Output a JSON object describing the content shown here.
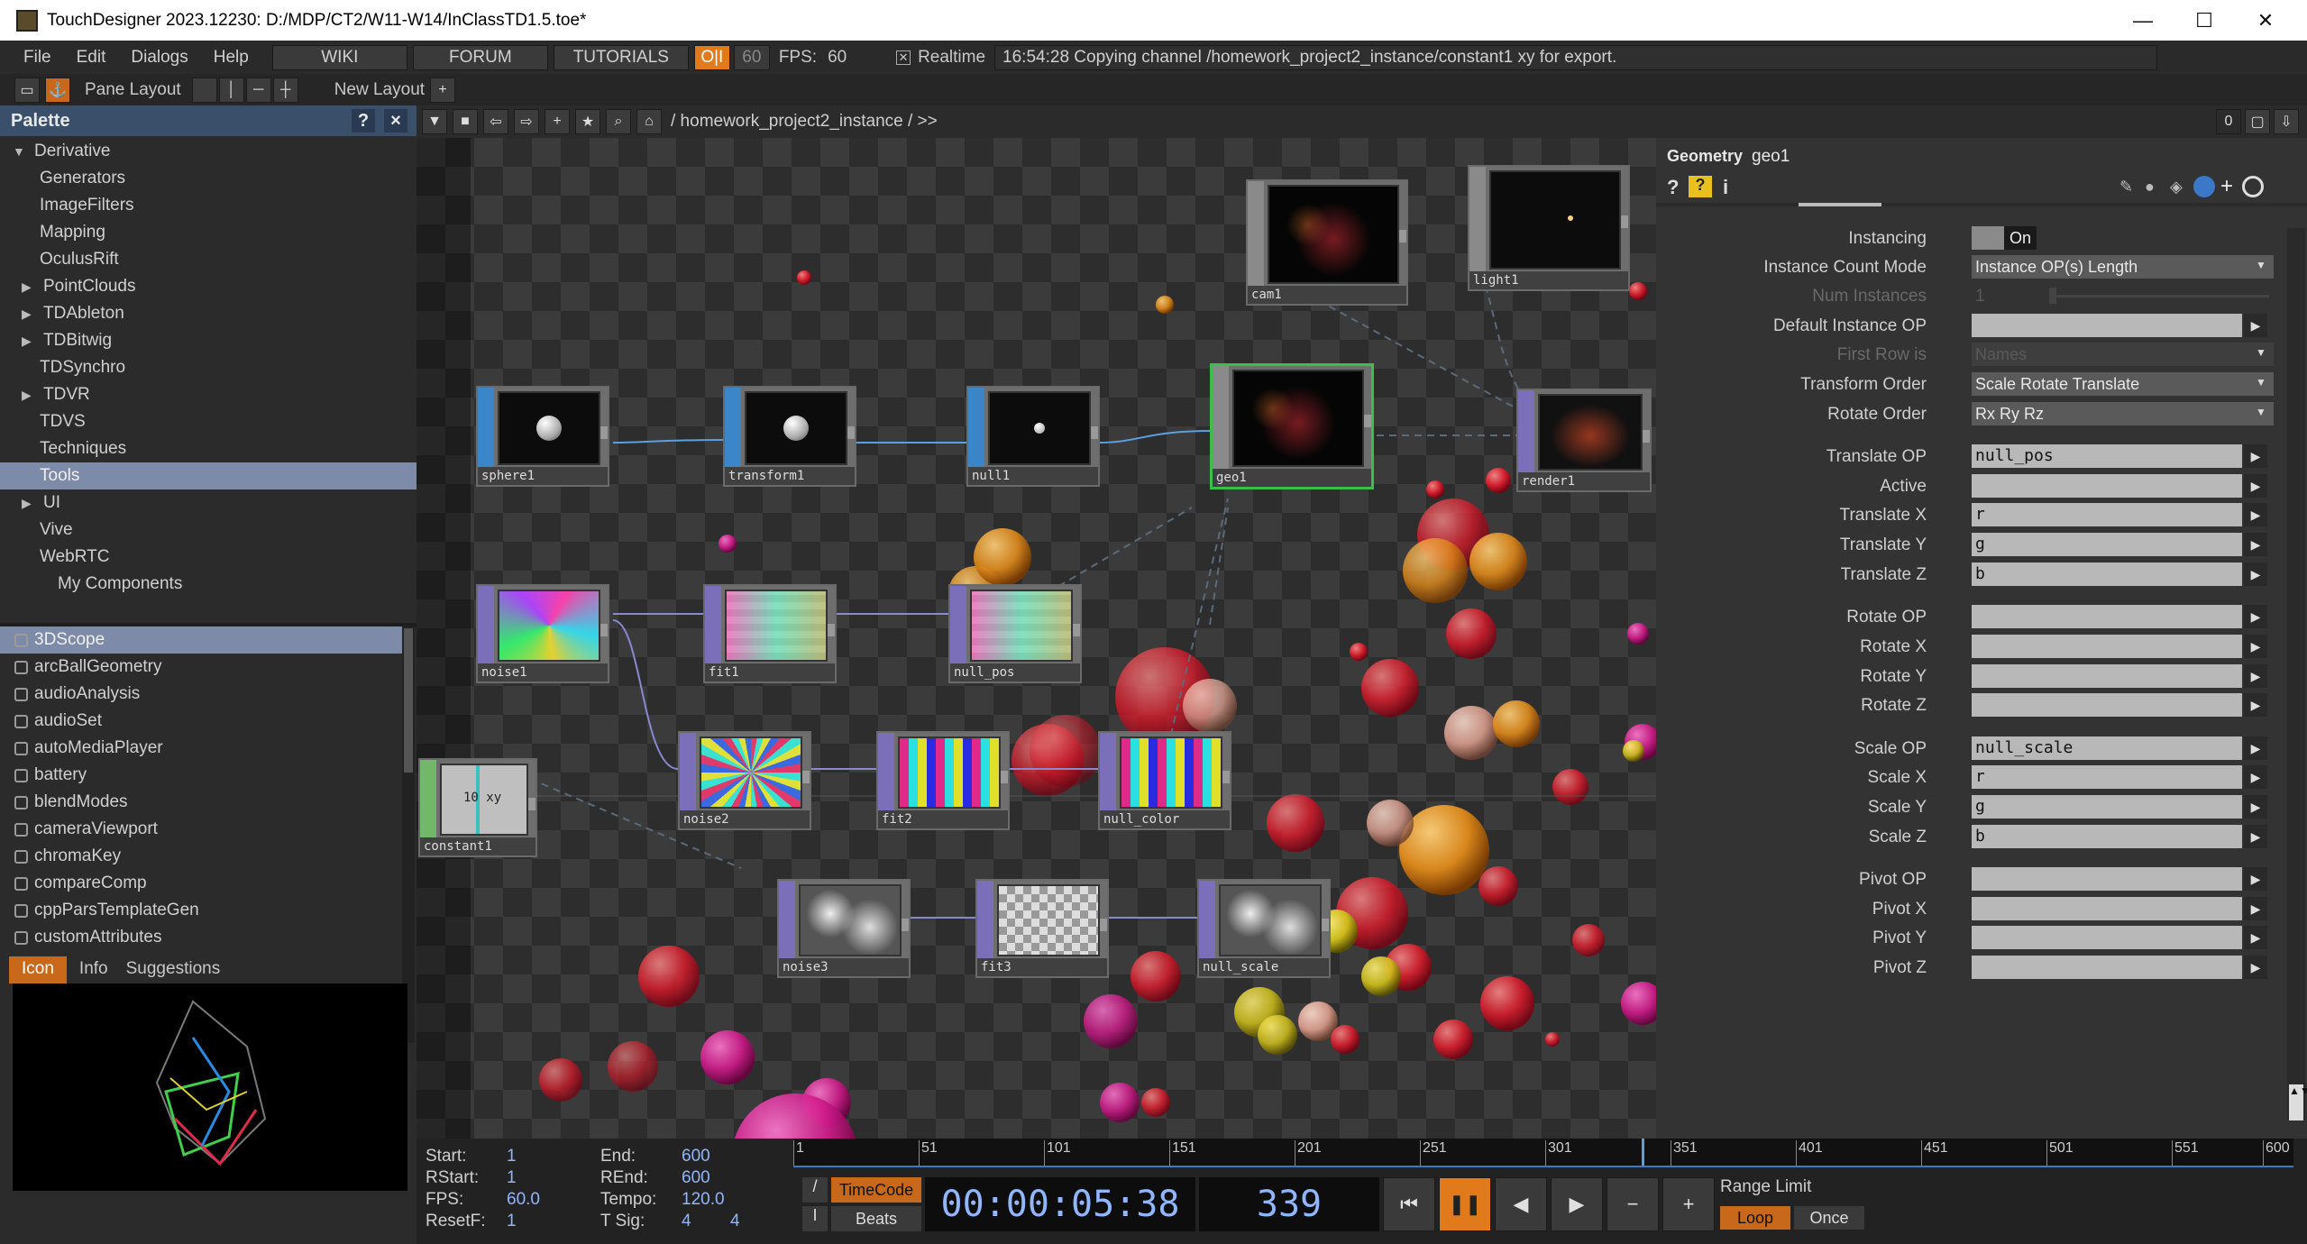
{
  "window": {
    "title": "TouchDesigner 2023.12230: D:/MDP/CT2/W11-W14/InClassTD1.5.toe*",
    "min": "—",
    "max": "☐",
    "close": "✕"
  },
  "menu": {
    "file": "File",
    "edit": "Edit",
    "dialogs": "Dialogs",
    "help": "Help",
    "wiki": "WIKI",
    "forum": "FORUM",
    "tutorials": "TUTORIALS",
    "oi": "O|I",
    "fps_target": "60",
    "fps_label": "FPS:",
    "fps_value": "60",
    "realtime": "Realtime",
    "status": "16:54:28 Copying channel /homework_project2_instance/constant1 xy for export."
  },
  "toolbar2": {
    "pane_layout": "Pane Layout",
    "new_layout": "New Layout",
    "plus": "+"
  },
  "palette": {
    "title": "Palette",
    "help": "?",
    "close": "×",
    "tree": [
      {
        "label": "Derivative",
        "indent": 0,
        "arrow": "▼",
        "selected": false
      },
      {
        "label": "Generators",
        "indent": 2,
        "arrow": "",
        "selected": false
      },
      {
        "label": "ImageFilters",
        "indent": 2,
        "arrow": "",
        "selected": false
      },
      {
        "label": "Mapping",
        "indent": 2,
        "arrow": "",
        "selected": false
      },
      {
        "label": "OculusRift",
        "indent": 2,
        "arrow": "",
        "selected": false
      },
      {
        "label": "PointClouds",
        "indent": 2,
        "arrow": "▶",
        "selected": false
      },
      {
        "label": "TDAbleton",
        "indent": 2,
        "arrow": "▶",
        "selected": false
      },
      {
        "label": "TDBitwig",
        "indent": 2,
        "arrow": "▶",
        "selected": false
      },
      {
        "label": "TDSynchro",
        "indent": 2,
        "arrow": "",
        "selected": false
      },
      {
        "label": "TDVR",
        "indent": 2,
        "arrow": "▶",
        "selected": false
      },
      {
        "label": "TDVS",
        "indent": 2,
        "arrow": "",
        "selected": false
      },
      {
        "label": "Techniques",
        "indent": 2,
        "arrow": "",
        "selected": false
      },
      {
        "label": "Tools",
        "indent": 2,
        "arrow": "",
        "selected": true
      },
      {
        "label": "UI",
        "indent": 2,
        "arrow": "▶",
        "selected": false
      },
      {
        "label": "Vive",
        "indent": 2,
        "arrow": "",
        "selected": false
      },
      {
        "label": "WebRTC",
        "indent": 2,
        "arrow": "",
        "selected": false
      },
      {
        "label": "My Components",
        "indent": 1,
        "arrow": "",
        "selected": false
      }
    ],
    "components": [
      "3DScope",
      "arcBallGeometry",
      "audioAnalysis",
      "audioSet",
      "autoMediaPlayer",
      "battery",
      "blendModes",
      "cameraViewport",
      "chromaKey",
      "compareComp",
      "cppParsTemplateGen",
      "customAttributes"
    ],
    "tabs": {
      "icon": "Icon",
      "info": "Info",
      "suggestions": "Suggestions"
    }
  },
  "network": {
    "path": "/ homework_project2_instance / >>",
    "right_count": "0",
    "nodes": [
      {
        "id": "sphere1",
        "name": "sphere1"
      },
      {
        "id": "transform1",
        "name": "transform1"
      },
      {
        "id": "null1",
        "name": "null1"
      },
      {
        "id": "geo1",
        "name": "geo1"
      },
      {
        "id": "cam1",
        "name": "cam1"
      },
      {
        "id": "light1",
        "name": "light1"
      },
      {
        "id": "render1",
        "name": "render1"
      },
      {
        "id": "noise1",
        "name": "noise1"
      },
      {
        "id": "fit1",
        "name": "fit1"
      },
      {
        "id": "null_pos",
        "name": "null_pos"
      },
      {
        "id": "constant1",
        "name": "constant1",
        "value": "10 xy"
      },
      {
        "id": "noise2",
        "name": "noise2"
      },
      {
        "id": "fit2",
        "name": "fit2"
      },
      {
        "id": "null_color",
        "name": "null_color"
      },
      {
        "id": "noise3",
        "name": "noise3"
      },
      {
        "id": "fit3",
        "name": "fit3"
      },
      {
        "id": "null_scale",
        "name": "null_scale"
      }
    ]
  },
  "params": {
    "op_type": "Geometry",
    "op_name": "geo1",
    "rows": [
      {
        "label": "Instancing",
        "kind": "toggle",
        "value": "On",
        "dim": false
      },
      {
        "label": "Instance Count Mode",
        "kind": "menu",
        "value": "Instance OP(s) Length",
        "dim": false
      },
      {
        "label": "Num Instances",
        "kind": "slider",
        "value": "1",
        "dim": true
      },
      {
        "label": "Default Instance OP",
        "kind": "field",
        "value": "",
        "dim": false
      },
      {
        "label": "First Row is",
        "kind": "menu",
        "value": "Names",
        "dim": true
      },
      {
        "label": "Transform Order",
        "kind": "menu",
        "value": "Scale Rotate Translate",
        "dim": false
      },
      {
        "label": "Rotate Order",
        "kind": "menu",
        "value": "Rx Ry Rz",
        "dim": false
      },
      {
        "label": "Translate OP",
        "kind": "field",
        "value": "null_pos",
        "dim": false
      },
      {
        "label": "Active",
        "kind": "field",
        "value": "",
        "dim": false
      },
      {
        "label": "Translate X",
        "kind": "field",
        "value": "r",
        "dim": false
      },
      {
        "label": "Translate Y",
        "kind": "field",
        "value": "g",
        "dim": false
      },
      {
        "label": "Translate Z",
        "kind": "field",
        "value": "b",
        "dim": false
      },
      {
        "label": "Rotate OP",
        "kind": "field",
        "value": "",
        "dim": false
      },
      {
        "label": "Rotate X",
        "kind": "field",
        "value": "",
        "dim": false
      },
      {
        "label": "Rotate Y",
        "kind": "field",
        "value": "",
        "dim": false
      },
      {
        "label": "Rotate Z",
        "kind": "field",
        "value": "",
        "dim": false
      },
      {
        "label": "Scale OP",
        "kind": "field",
        "value": "null_scale",
        "dim": false
      },
      {
        "label": "Scale X",
        "kind": "field",
        "value": "r",
        "dim": false
      },
      {
        "label": "Scale Y",
        "kind": "field",
        "value": "g",
        "dim": false
      },
      {
        "label": "Scale Z",
        "kind": "field",
        "value": "b",
        "dim": false
      },
      {
        "label": "Pivot OP",
        "kind": "field",
        "value": "",
        "dim": false
      },
      {
        "label": "Pivot X",
        "kind": "field",
        "value": "",
        "dim": false
      },
      {
        "label": "Pivot Y",
        "kind": "field",
        "value": "",
        "dim": false
      },
      {
        "label": "Pivot Z",
        "kind": "field",
        "value": "",
        "dim": false
      }
    ]
  },
  "timeline": {
    "start_l": "Start:",
    "start": "1",
    "end_l": "End:",
    "end": "600",
    "rstart_l": "RStart:",
    "rstart": "1",
    "rend_l": "REnd:",
    "rend": "600",
    "fps_l": "FPS:",
    "fps": "60.0",
    "tempo_l": "Tempo:",
    "tempo": "120.0",
    "resetf_l": "ResetF:",
    "resetf": "1",
    "tsig_l": "T Sig:",
    "tsig_a": "4",
    "tsig_b": "4",
    "ruler": [
      "1",
      "51",
      "101",
      "151",
      "201",
      "251",
      "301",
      "351",
      "401",
      "451",
      "501",
      "551",
      "600"
    ],
    "timecode_btn": "TimeCode",
    "beats_btn": "Beats",
    "timecode": "00:00:05:38",
    "frame": "339",
    "range_limit": "Range Limit",
    "loop": "Loop",
    "once": "Once"
  },
  "colors": {
    "accent": "#f0a030",
    "selection": "#7d8aa8",
    "link": "#5aa0e0"
  }
}
